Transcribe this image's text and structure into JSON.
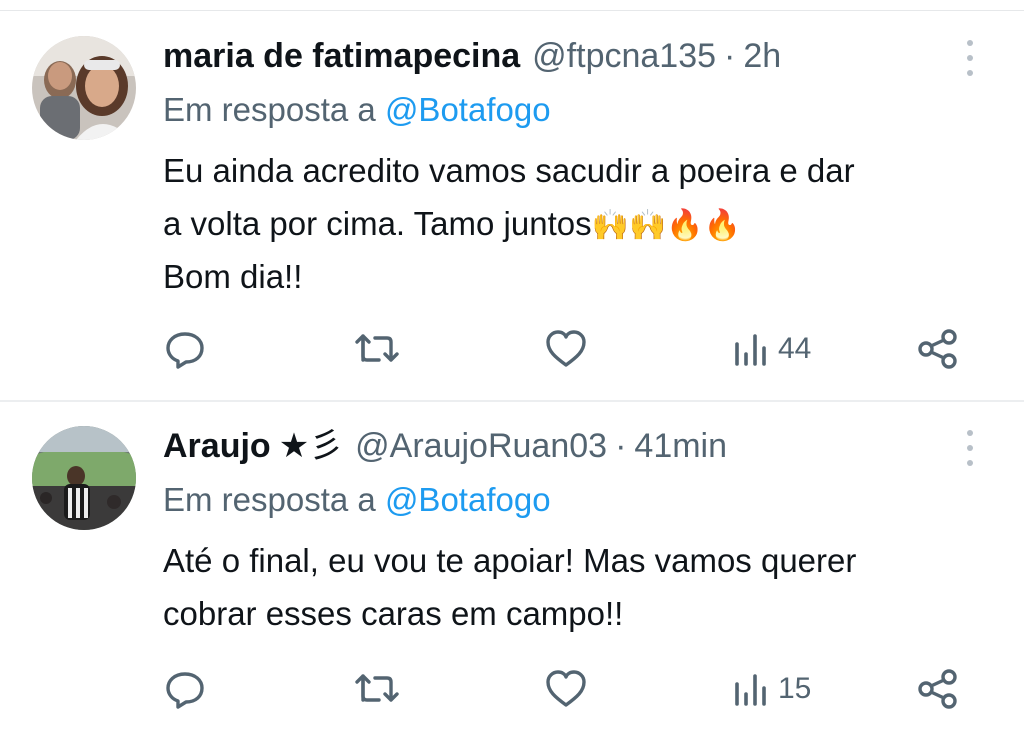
{
  "tweets": [
    {
      "name": "maria de fatimapecina",
      "badge": "",
      "handle": "@ftpcna135",
      "separator": "·",
      "time": "2h",
      "reply_prefix": "Em resposta a ",
      "reply_mention": "@Botafogo",
      "body_lines": [
        "Eu ainda acredito vamos sacudir a poeira e dar",
        "a volta por cima. Tamo juntos",
        "Bom dia!!"
      ],
      "body_emojis": "🙌🙌🔥🔥",
      "views": "44",
      "icons": [
        "reply-icon",
        "retweet-icon",
        "like-icon",
        "views-icon",
        "share-icon",
        "more-icon"
      ]
    },
    {
      "name": "Araujo",
      "badge": "★彡",
      "handle": "@AraujoRuan03",
      "separator": "·",
      "time": "41min",
      "reply_prefix": "Em resposta a ",
      "reply_mention": "@Botafogo",
      "body_lines": [
        "Até o final, eu vou te apoiar! Mas vamos querer",
        "cobrar esses caras em campo!!"
      ],
      "views": "15",
      "icons": [
        "reply-icon",
        "retweet-icon",
        "like-icon",
        "views-icon",
        "share-icon",
        "more-icon"
      ]
    }
  ],
  "colors": {
    "text": "#0f1419",
    "secondary": "#536471",
    "link": "#1d9bf0",
    "divider": "#eceef0"
  }
}
